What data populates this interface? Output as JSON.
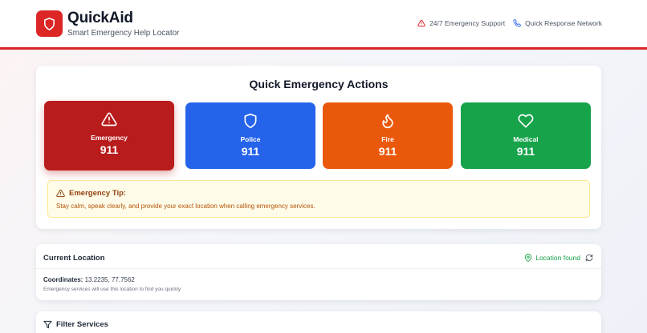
{
  "header": {
    "app_title": "QuickAid",
    "app_subtitle": "Smart Emergency Help Locator",
    "logo_icon": "shield-icon",
    "support_label": "24/7 Emergency Support",
    "support_icon": "warning-triangle-icon",
    "network_label": "Quick Response Network",
    "network_icon": "phone-icon",
    "accent_color": "#dc2626"
  },
  "quick_actions": {
    "title": "Quick Emergency Actions",
    "buttons": [
      {
        "label": "Emergency",
        "number": "911",
        "icon": "warning-triangle-icon",
        "color": "#b91c1c"
      },
      {
        "label": "Police",
        "number": "911",
        "icon": "shield-icon",
        "color": "#2563eb"
      },
      {
        "label": "Fire",
        "number": "911",
        "icon": "flame-icon",
        "color": "#ea580c"
      },
      {
        "label": "Medical",
        "number": "911",
        "icon": "heart-icon",
        "color": "#16a34a"
      }
    ],
    "tip": {
      "title": "Emergency Tip:",
      "text": "Stay calm, speak clearly, and provide your exact location when calling emergency services."
    }
  },
  "location": {
    "title": "Current Location",
    "status": "Location found",
    "coordinates_label": "Coordinates:",
    "coordinates_value": "13.2235, 77.7562",
    "note": "Emergency services will use this location to find you quickly"
  },
  "filter": {
    "title": "Filter Services"
  }
}
